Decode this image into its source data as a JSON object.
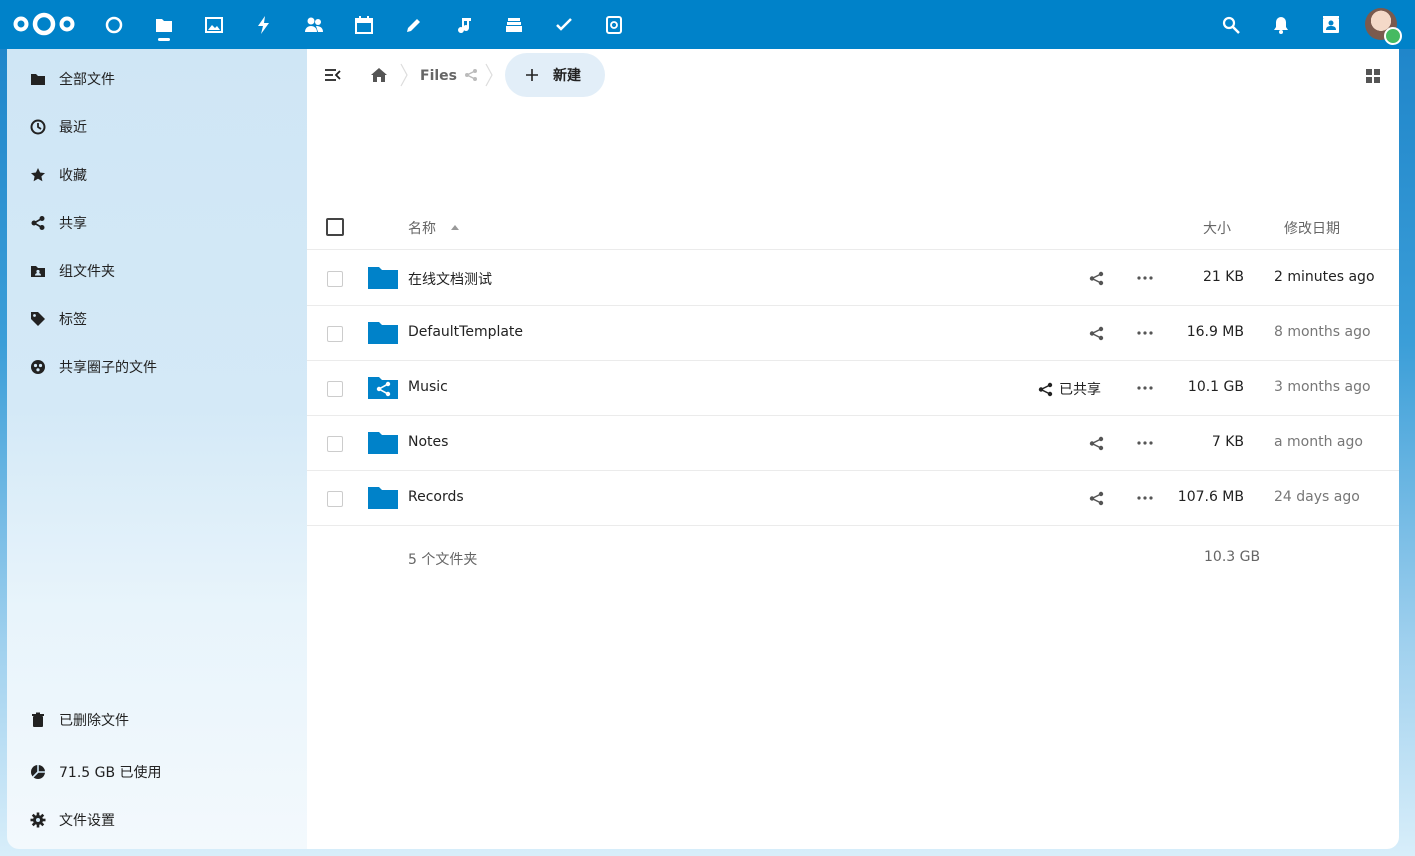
{
  "colors": {
    "brand": "#0082c9",
    "folder": "#0082c9",
    "sidebar_bg": "#d4e9f7",
    "quota_online": "#46ba61"
  },
  "topbar": {
    "apps": [
      "dashboard-icon",
      "files-icon",
      "photos-icon",
      "activity-icon",
      "contacts-icon",
      "calendar-icon",
      "notes-icon",
      "music-icon",
      "deck-icon",
      "tasks-icon",
      "cookbook-icon"
    ],
    "right": [
      "search-icon",
      "notifications-icon",
      "contacts-menu-icon",
      "avatar"
    ]
  },
  "sidebar": {
    "items": [
      {
        "label": "全部文件",
        "icon": "folder-icon"
      },
      {
        "label": "最近",
        "icon": "clock-icon"
      },
      {
        "label": "收藏",
        "icon": "star-icon"
      },
      {
        "label": "共享",
        "icon": "share-icon"
      },
      {
        "label": "组文件夹",
        "icon": "group-folder-icon"
      },
      {
        "label": "标签",
        "icon": "tag-icon"
      },
      {
        "label": "共享圈子的文件",
        "icon": "circles-icon"
      }
    ],
    "bottom": [
      {
        "label": "已删除文件",
        "icon": "trash-icon"
      },
      {
        "label": "71.5 GB 已使用",
        "icon": "pie-chart-icon"
      },
      {
        "label": "文件设置",
        "icon": "gear-icon"
      }
    ]
  },
  "breadcrumb": {
    "current": "Files",
    "new_label": "新建"
  },
  "table": {
    "headers": {
      "name": "名称",
      "size": "大小",
      "modified": "修改日期"
    },
    "rows": [
      {
        "name": "在线文档测试",
        "size": "21 KB",
        "modified": "2 minutes ago",
        "shared": false,
        "date_color": "#222222"
      },
      {
        "name": "DefaultTemplate",
        "size": "16.9 MB",
        "modified": "8 months ago",
        "shared": false,
        "date_color": "#777777"
      },
      {
        "name": "Music",
        "size": "10.1 GB",
        "modified": "3 months ago",
        "shared": true,
        "shared_label": "已共享",
        "date_color": "#777777"
      },
      {
        "name": "Notes",
        "size": "7 KB",
        "modified": "a month ago",
        "shared": false,
        "date_color": "#777777"
      },
      {
        "name": "Records",
        "size": "107.6 MB",
        "modified": "24 days ago",
        "shared": false,
        "date_color": "#777777"
      }
    ],
    "summary": {
      "count": "5 个文件夹",
      "total_size": "10.3 GB"
    }
  }
}
